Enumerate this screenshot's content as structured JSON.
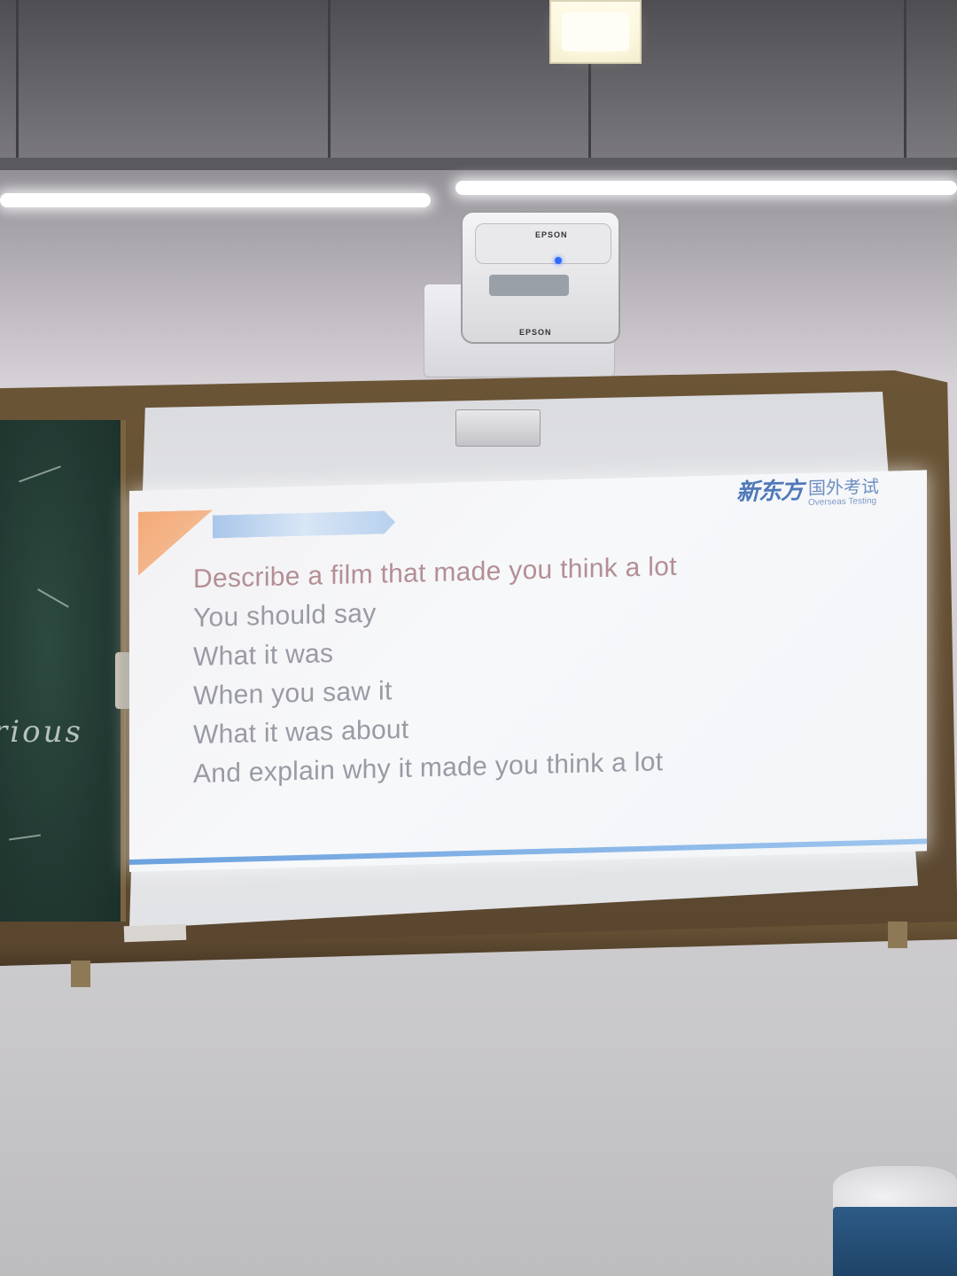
{
  "projector": {
    "brand": "EPSON"
  },
  "chalkboard": {
    "text": "rious"
  },
  "slide": {
    "logo_cn": "新东方",
    "logo_cn2": "国外考试",
    "logo_en": "Overseas Testing",
    "lines": [
      "Describe a film that made you think a lot",
      "You should say",
      "What it was",
      "When you saw it",
      "What it was about",
      "And explain why it made you think a lot"
    ]
  },
  "colors": {
    "slide_text": "#9a9aa4",
    "slide_accent_bar": "#6ca2df",
    "slide_corner": "#f3a977",
    "chalkboard": "#223a33",
    "board_frame": "#6b5536"
  }
}
